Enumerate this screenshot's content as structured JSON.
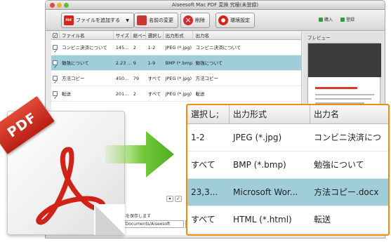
{
  "window": {
    "title": "Aiseesoft Mac PDF 変換 究極(未登録)"
  },
  "toolbar": {
    "add_file_label": "ファイルを追加する",
    "rename_label": "名前の変更",
    "delete_label": "削除",
    "settings_label": "環境設定",
    "buy_label": "購入",
    "register_label": "登録"
  },
  "file_list": {
    "columns": [
      "ファイル名",
      "サイズ",
      "総ページ",
      "選択し",
      "出力形式",
      "出力名"
    ],
    "rows": [
      {
        "name": "コンビニ決済について",
        "size": "145...",
        "pages": "2",
        "selected": "1-2",
        "format": "JPEG (*.jpg)",
        "output": "コンビニ決済について"
      },
      {
        "name": "勉強について",
        "size": "2.23 ...",
        "pages": "9",
        "selected": "1-9",
        "format": "BMP (*.bmp)",
        "output": "勉強について"
      },
      {
        "name": "方法コピー",
        "size": "450...",
        "pages": "79",
        "selected": "すべて",
        "format": "JPEG (*.jpg)",
        "output": "方法コピー"
      },
      {
        "name": "転送",
        "size": "201...",
        "pages": "2",
        "selected": "すべて",
        "format": "JPEG (*.jpg)",
        "output": "転送"
      }
    ]
  },
  "preview": {
    "label": "プレビュー"
  },
  "bottom": {
    "save_label": "ートファイルを保存します",
    "path_value": "s/test/Documents/Aiseesoft",
    "browse_label": "..."
  },
  "pdf_icon": {
    "ribbon_text": "PDF"
  },
  "zoom_table": {
    "columns": [
      "選択し;",
      "出力形式",
      "出力名"
    ],
    "rows": [
      {
        "selected": "1-2",
        "format": "JPEG (*.jpg)",
        "output": "コンビニ決済につ"
      },
      {
        "selected": "すべて",
        "format": "BMP (*.bmp)",
        "output": "勉強について"
      },
      {
        "selected": "23,3...",
        "format": "Microsoft Wor...",
        "output": "方法コピー.docx"
      },
      {
        "selected": "すべて",
        "format": "HTML (*.html)",
        "output": "転送"
      }
    ]
  },
  "colors": {
    "highlight_row": "#9fcdd8",
    "zoom_border": "#f08a10",
    "pdf_red": "#d0241a",
    "arrow_green": "#5fbf2a"
  }
}
